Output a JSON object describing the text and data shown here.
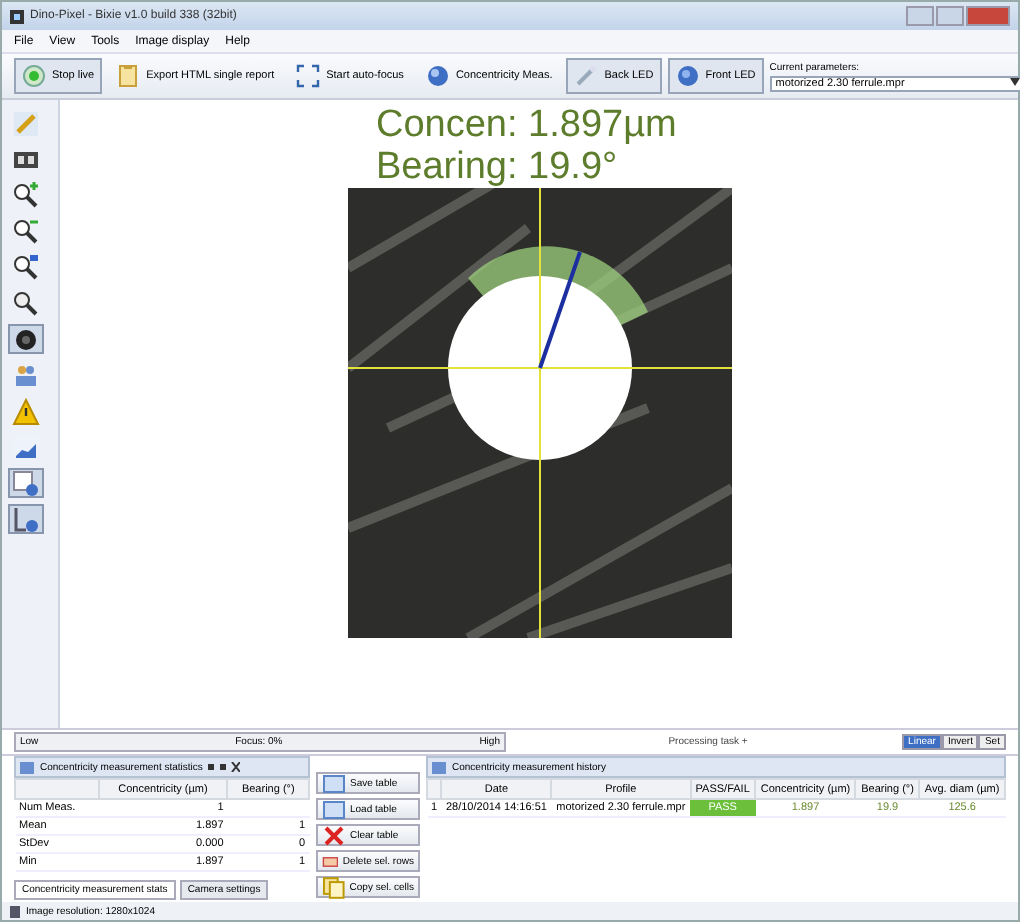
{
  "window": {
    "title": "Dino-Pixel - Bixie v1.0 build 338 (32bit)"
  },
  "menu": [
    "File",
    "View",
    "Tools",
    "Image display",
    "Help"
  ],
  "toolbar": {
    "buttons": [
      {
        "label": "Stop live",
        "kind": "live",
        "pressed": true
      },
      {
        "label": "Export HTML single report",
        "kind": "report",
        "pressed": false
      },
      {
        "label": "Start auto-focus",
        "kind": "focus",
        "pressed": false
      },
      {
        "label": "Concentricity Meas.",
        "kind": "measure",
        "pressed": false
      },
      {
        "label": "Back LED",
        "kind": "backled",
        "pressed": true
      },
      {
        "label": "Front LED",
        "kind": "frontled",
        "pressed": true
      }
    ],
    "parameters_label": "Current parameters:",
    "parameters_value": "motorized 2.30 ferrule.mpr"
  },
  "tools": [
    {
      "kind": "pencil",
      "selected": false
    },
    {
      "kind": "film",
      "selected": false
    },
    {
      "kind": "zoomin",
      "selected": false
    },
    {
      "kind": "zoomout",
      "selected": false
    },
    {
      "kind": "zoomfit",
      "selected": false
    },
    {
      "kind": "zoomreset",
      "selected": false
    },
    {
      "kind": "lens",
      "selected": true
    },
    {
      "kind": "people",
      "selected": false
    },
    {
      "kind": "warning",
      "selected": false
    },
    {
      "kind": "chart",
      "selected": false
    },
    {
      "kind": "imagegear",
      "selected": true
    },
    {
      "kind": "measure",
      "selected": true
    }
  ],
  "viewer": {
    "concentricity": "Concen: 1.897µm",
    "bearing": "Bearing: 19.9°"
  },
  "focus_bar": {
    "low": "Low",
    "focus": "Focus: 0%",
    "high": "High"
  },
  "display_buttons": [
    {
      "label": "Linear",
      "selected": true
    },
    {
      "label": "Invert",
      "selected": false
    },
    {
      "label": "Set",
      "selected": false
    }
  ],
  "processing": "Processing task +",
  "stats_panel": {
    "title": "Concentricity measurement statistics",
    "columns": [
      "Concentricity (µm)",
      "Bearing (°)"
    ],
    "rows": [
      {
        "label": "Num Meas.",
        "concentricity": "1"
      },
      {
        "label": "Mean",
        "concentricity": "1.897",
        "bearing": "1"
      },
      {
        "label": "StDev",
        "concentricity": "0.000",
        "bearing": "0"
      },
      {
        "label": "Min",
        "concentricity": "1.897",
        "bearing": "1"
      }
    ],
    "tabs": [
      {
        "label": "Concentricity measurement stats",
        "selected": true
      },
      {
        "label": "Camera settings",
        "selected": false
      }
    ]
  },
  "actions": [
    {
      "label": "Save table",
      "kind": "save"
    },
    {
      "label": "Load table",
      "kind": "load"
    },
    {
      "label": "Clear table",
      "kind": "clear"
    },
    {
      "label": "Delete sel. rows",
      "kind": "delete"
    },
    {
      "label": "Copy sel. cells",
      "kind": "copy"
    }
  ],
  "history_panel": {
    "title": "Concentricity measurement history",
    "columns": [
      "Date",
      "Profile",
      "PASS/FAIL",
      "Concentricity (µm)",
      "Bearing (°)",
      "Avg. diam (µm)"
    ],
    "rows": [
      {
        "index": "1",
        "date": "28/10/2014 14:16:51",
        "profile": "motorized 2.30 ferrule.mpr",
        "result": "PASS",
        "passed": true,
        "concentricity": "1.897",
        "bearing": "19.9",
        "diameter": "125.6"
      }
    ]
  },
  "status_bar": "Image resolution: 1280x1024"
}
